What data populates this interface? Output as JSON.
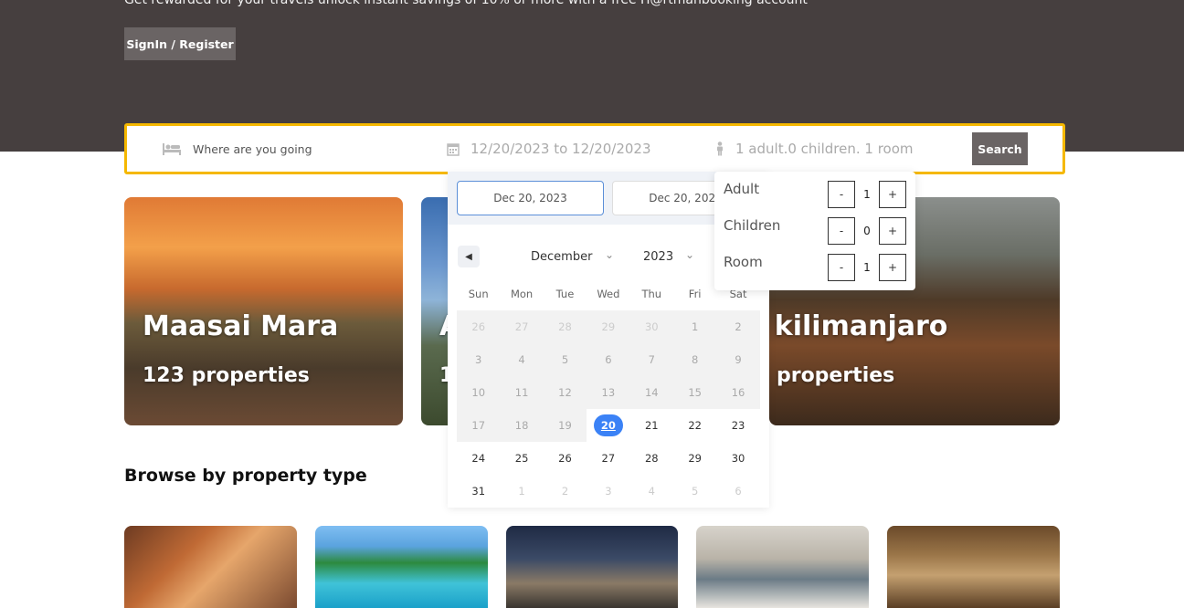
{
  "hero": {
    "tagline": "Get rewarded for your travels unlock instant savings of 10% or more with a free H@rtmanbooking account",
    "signin_label": "SignIn / Register"
  },
  "search": {
    "destination_placeholder": "Where are you going",
    "dates_text": "12/20/2023 to 12/20/2023",
    "guests_text": "1 adult.0 children. 1 room",
    "search_label": "Search"
  },
  "destinations": [
    {
      "title": "Maasai Mara",
      "count": "123 properties"
    },
    {
      "title": "A",
      "count": "1"
    },
    {
      "title": "t kilimanjaro",
      "count": "3 properties"
    }
  ],
  "section_title": "Browse by property type",
  "datepicker": {
    "start_date": "Dec 20, 2023",
    "end_date": "Dec 20, 2023",
    "month": "December",
    "year": "2023",
    "weekdays": [
      "Sun",
      "Mon",
      "Tue",
      "Wed",
      "Thu",
      "Fri",
      "Sat"
    ],
    "weeks": [
      [
        "26",
        "27",
        "28",
        "29",
        "30",
        "1",
        "2"
      ],
      [
        "3",
        "4",
        "5",
        "6",
        "7",
        "8",
        "9"
      ],
      [
        "10",
        "11",
        "12",
        "13",
        "14",
        "15",
        "16"
      ],
      [
        "17",
        "18",
        "19",
        "20",
        "21",
        "22",
        "23"
      ],
      [
        "24",
        "25",
        "26",
        "27",
        "28",
        "29",
        "30"
      ],
      [
        "31",
        "1",
        "2",
        "3",
        "4",
        "5",
        "6"
      ]
    ],
    "selected_day": "20"
  },
  "guests": {
    "rows": [
      {
        "label": "Adult",
        "value": "1"
      },
      {
        "label": "Children",
        "value": "0"
      },
      {
        "label": "Room",
        "value": "1"
      }
    ],
    "minus_label": "-",
    "plus_label": "+"
  },
  "colors": {
    "hero_bg": "#463f3f",
    "accent_border": "#f5b800",
    "button_bg": "#6a6464",
    "selected_day": "#3b82f6"
  }
}
